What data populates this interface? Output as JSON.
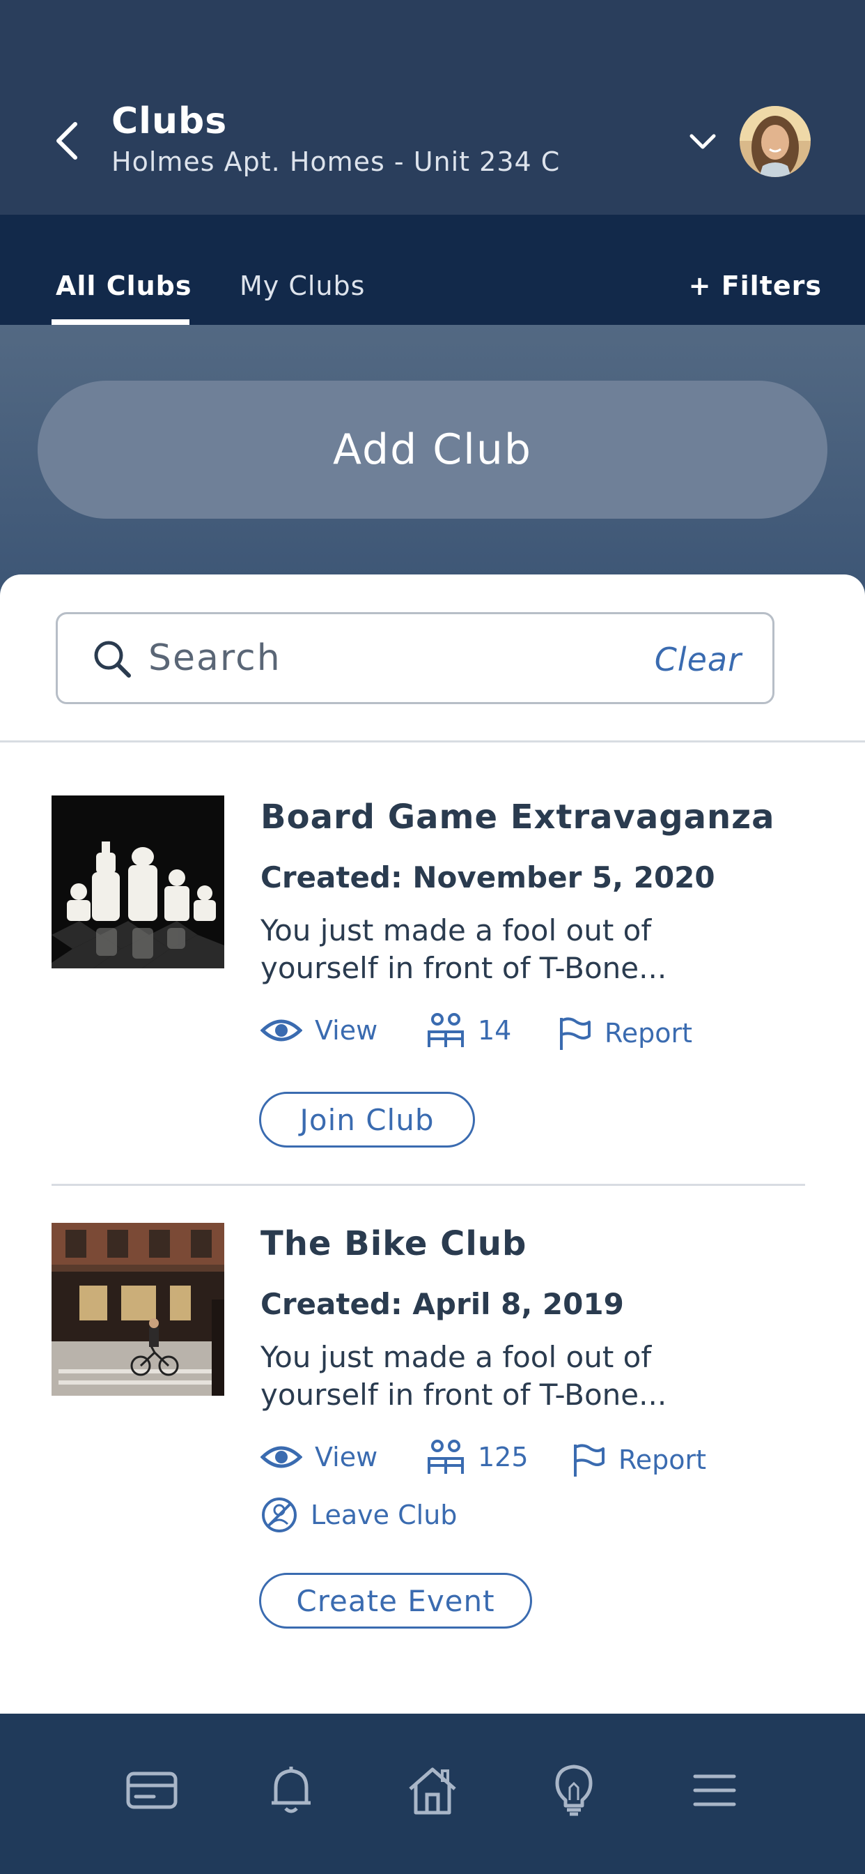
{
  "header": {
    "title": "Clubs",
    "subtitle": "Holmes Apt. Homes - Unit 234 C"
  },
  "tabs": [
    {
      "label": "All Clubs",
      "active": true
    },
    {
      "label": "My Clubs",
      "active": false
    }
  ],
  "filters_label": "+ Filters",
  "add_club_label": "Add Club",
  "search": {
    "placeholder": "Search",
    "value": "",
    "clear_label": "Clear"
  },
  "clubs": [
    {
      "name": "Board Game Extravaganza",
      "created": "Created: November 5, 2020",
      "description": "You just made a fool out of yourself in front of T-Bone...",
      "view_label": "View",
      "members": "14",
      "report_label": "Report",
      "button_label": "Join Club"
    },
    {
      "name": "The Bike Club",
      "created": "Created: April 8, 2019",
      "description": "You just made a fool out of yourself in front of T-Bone...",
      "view_label": "View",
      "members": "125",
      "report_label": "Report",
      "leave_label": "Leave Club",
      "button_label": "Create Event"
    }
  ],
  "bottom_nav": [
    "card-icon",
    "bell-icon",
    "home-icon",
    "lightbulb-icon",
    "menu-icon"
  ],
  "colors": {
    "header_bg": "#2a3e5c",
    "tabs_bg": "#12294a",
    "accent": "#3a6bb0",
    "nav_bg": "#203a5a"
  }
}
